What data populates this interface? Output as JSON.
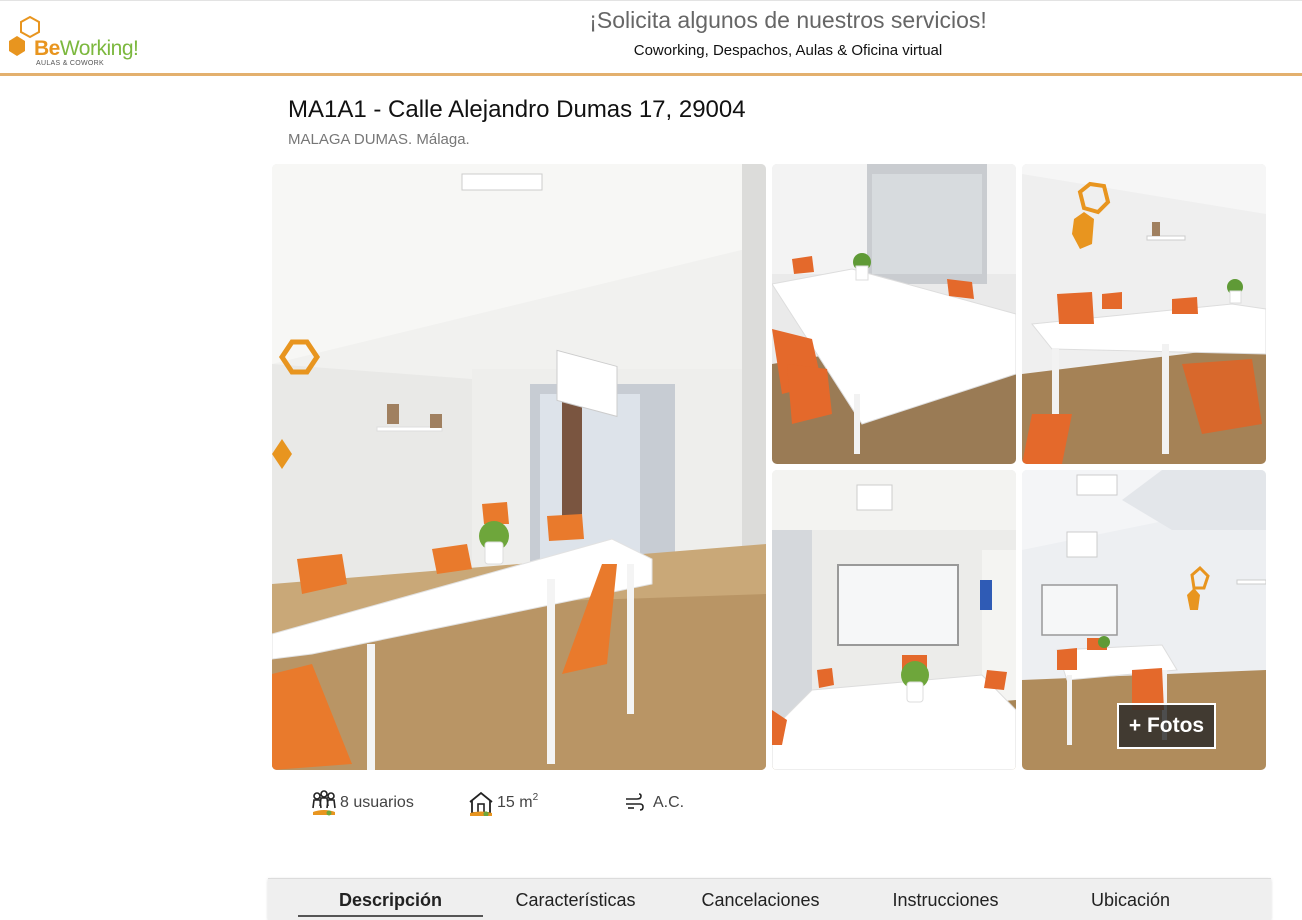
{
  "header": {
    "logo_brand_be": "Be",
    "logo_brand_working": "Working!",
    "logo_tagline": "AULAS & COWORK",
    "promo_title": "¡Solicita algunos de nuestros servicios!",
    "promo_subtitle": "Coworking, Despachos, Aulas & Oficina virtual"
  },
  "space": {
    "title": "MA1A1 - Calle Alejandro Dumas 17, 29004",
    "subtitle": "MALAGA DUMAS. Málaga."
  },
  "gallery": {
    "more_photos_label": "+ Fotos",
    "photo_count": 5
  },
  "features": {
    "users": "8 usuarios",
    "area_value": "15 m",
    "area_unit_sup": "2",
    "ac": "A.C.",
    "icons": [
      "users-icon",
      "house-icon",
      "air-conditioning-icon"
    ]
  },
  "tabs": [
    {
      "label": "Descripción",
      "active": true
    },
    {
      "label": "Características",
      "active": false
    },
    {
      "label": "Cancelaciones",
      "active": false
    },
    {
      "label": "Instrucciones",
      "active": false
    },
    {
      "label": "Ubicación",
      "active": false
    }
  ],
  "colors": {
    "accent_orange": "#e8951f",
    "brand_green": "#7cb83e",
    "header_rule": "#e3b06e"
  }
}
